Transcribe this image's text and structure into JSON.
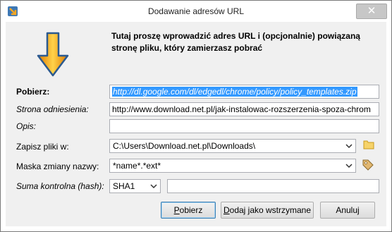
{
  "window": {
    "title": "Dodawanie adresów URL",
    "close_label": "✕"
  },
  "instructions": "Tutaj proszę wprowadzić adres URL i (opcjonalnie) powiązaną stronę pliku, który zamierzasz pobrać",
  "fields": {
    "download_label": "Pobierz:",
    "download_value": "http://dl.google.com/dl/edgedl/chrome/policy/policy_templates.zip",
    "referer_label": "Strona odniesienia:",
    "referer_value": "http://www.download.net.pl/jak-instalowac-rozszerzenia-spoza-chrom",
    "description_label": "Opis:",
    "description_value": "",
    "save_to_label": "Zapisz pliki w:",
    "save_to_value": "C:\\Users\\Download.net.pl\\Downloads\\",
    "rename_mask_label": "Maska zmiany nazwy:",
    "rename_mask_value": "*name*.*ext*",
    "checksum_label": "Suma kontrolna (hash):",
    "checksum_type": "SHA1",
    "checksum_value": ""
  },
  "buttons": {
    "download_first": "P",
    "download_rest": "obierz",
    "queue_prefix": "D",
    "queue_rest": "odaj jako wstrzymane",
    "cancel": "Anuluj"
  },
  "icons": {
    "app": "download-arrow-icon",
    "main": "orange-down-arrow-icon",
    "folder": "folder-icon",
    "tag": "tag-icon",
    "dropdown": "chevron-down-icon"
  },
  "colors": {
    "selection": "#3399ff",
    "arrow_orange": "#f39c12",
    "arrow_blue": "#2c6aa8"
  }
}
